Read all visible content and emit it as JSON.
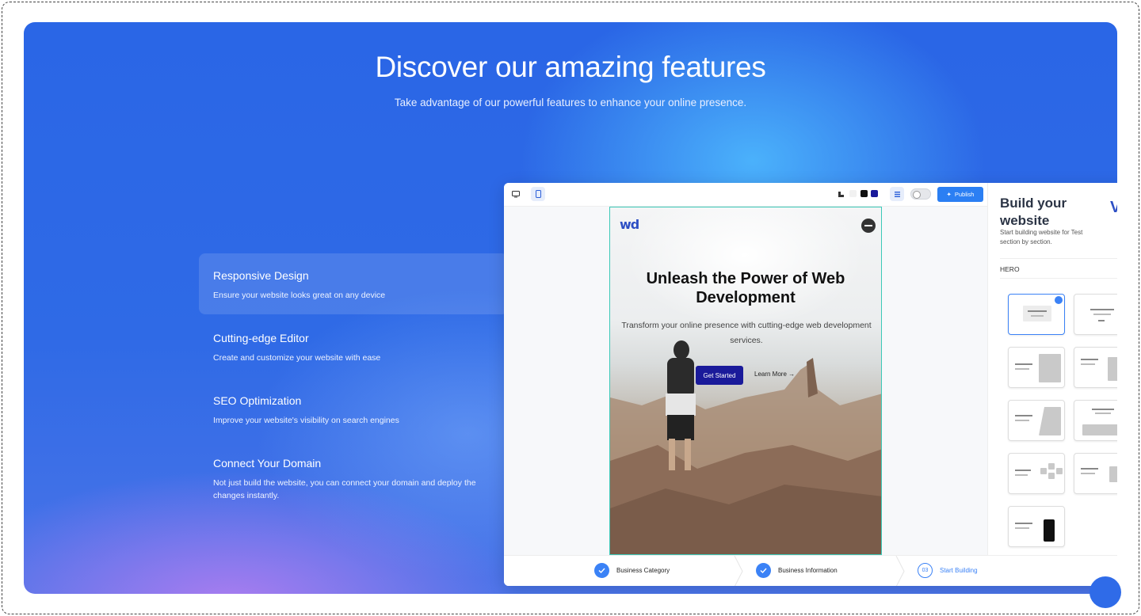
{
  "hero": {
    "title": "Discover our amazing features",
    "subtitle": "Take advantage of our powerful features to enhance your online presence."
  },
  "features": [
    {
      "title": "Responsive Design",
      "desc": "Ensure your website looks great on any device",
      "active": true
    },
    {
      "title": "Cutting-edge Editor",
      "desc": "Create and customize your website with ease",
      "active": false
    },
    {
      "title": "SEO Optimization",
      "desc": "Improve your website's visibility on search engines",
      "active": false
    },
    {
      "title": "Connect Your Domain",
      "desc": "Not just build the website, you can connect your domain and deploy the changes instantly.",
      "active": false
    }
  ],
  "editor": {
    "publish_label": "Publish",
    "swatches": [
      "#f1f1f1",
      "#111111",
      "#1a1a9a"
    ],
    "preview": {
      "logo": "wd",
      "title": "Unleash the Power of Web Development",
      "desc": "Transform your online presence with cutting-edge web development services.",
      "cta_primary": "Get Started",
      "cta_secondary": "Learn More →"
    },
    "sidebar": {
      "title": "Build your website",
      "subtitle": "Start building website for Test section by section.",
      "section_label": "HERO",
      "logo_fragment": "V"
    },
    "steps": [
      {
        "label": "Business Category",
        "done": true
      },
      {
        "label": "Business Information",
        "done": true
      },
      {
        "number": "03",
        "label": "Start Building",
        "done": false
      }
    ]
  },
  "colors": {
    "accent": "#2b7ff3",
    "panel": "#2f6ae6",
    "preview_border": "#3cc9b8",
    "cta": "#1a1a9a"
  }
}
